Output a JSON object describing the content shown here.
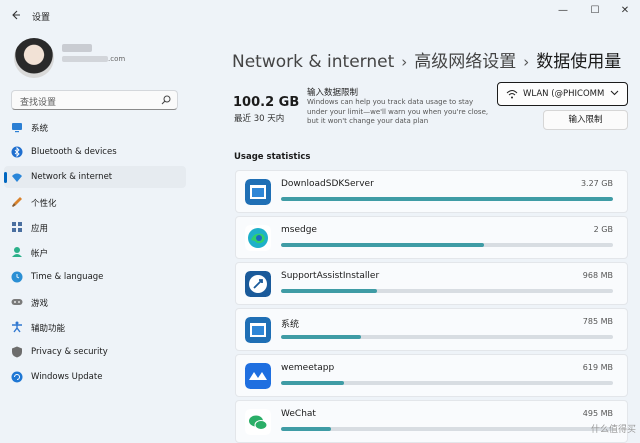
{
  "window": {
    "title": "设置",
    "controls": {
      "minimize": "—",
      "maximize": "☐",
      "close": "✕"
    }
  },
  "user": {
    "email_suffix": ".com"
  },
  "search": {
    "placeholder": "查找设置"
  },
  "sidebar": {
    "items": [
      {
        "label": "系统",
        "icon": "system-icon",
        "color": "#2b7fd4"
      },
      {
        "label": "Bluetooth & devices",
        "icon": "bluetooth-icon",
        "color": "#1f6fcf"
      },
      {
        "label": "Network & internet",
        "icon": "wifi-icon",
        "color": "#2a86d9",
        "active": true
      },
      {
        "label": "个性化",
        "icon": "brush-icon",
        "color": "#d9822b"
      },
      {
        "label": "应用",
        "icon": "apps-icon",
        "color": "#4a6fa0"
      },
      {
        "label": "帐户",
        "icon": "account-icon",
        "color": "#2bb08a"
      },
      {
        "label": "Time & language",
        "icon": "globe-clock-icon",
        "color": "#2b8fd4"
      },
      {
        "label": "游戏",
        "icon": "gamepad-icon",
        "color": "#7a7a7a"
      },
      {
        "label": "辅助功能",
        "icon": "accessibility-icon",
        "color": "#2f77d0"
      },
      {
        "label": "Privacy & security",
        "icon": "shield-icon",
        "color": "#6d6d6d"
      },
      {
        "label": "Windows Update",
        "icon": "update-icon",
        "color": "#1f77d4"
      }
    ]
  },
  "breadcrumb": {
    "level1": "Network & internet",
    "level2": "高级网络设置",
    "level3": "数据使用量",
    "separator": "›"
  },
  "usage": {
    "value": "100.2 GB",
    "period": "最近 30 天内"
  },
  "limit": {
    "title": "输入数据限制",
    "description": "Windows can help you track data usage to stay under your limit—we'll warn you when you're close, but it won't change your data plan",
    "button_label": "输入限制"
  },
  "network_select": {
    "selected": "WLAN (@PHICOMM"
  },
  "usage_stats": {
    "heading": "Usage statistics",
    "apps": [
      {
        "name": "DownloadSDKServer",
        "size": "3.27 GB",
        "fraction": 1.0,
        "icon": "downloadsdk-icon"
      },
      {
        "name": "msedge",
        "size": "2 GB",
        "fraction": 0.61,
        "icon": "edge-icon"
      },
      {
        "name": "SupportAssistInstaller",
        "size": "968 MB",
        "fraction": 0.29,
        "icon": "supportassist-icon"
      },
      {
        "name": "系统",
        "size": "785 MB",
        "fraction": 0.24,
        "icon": "system-window-icon"
      },
      {
        "name": "wemeetapp",
        "size": "619 MB",
        "fraction": 0.19,
        "icon": "wemeet-icon"
      },
      {
        "name": "WeChat",
        "size": "495 MB",
        "fraction": 0.15,
        "icon": "wechat-icon"
      }
    ]
  },
  "watermark": "什么值得买"
}
